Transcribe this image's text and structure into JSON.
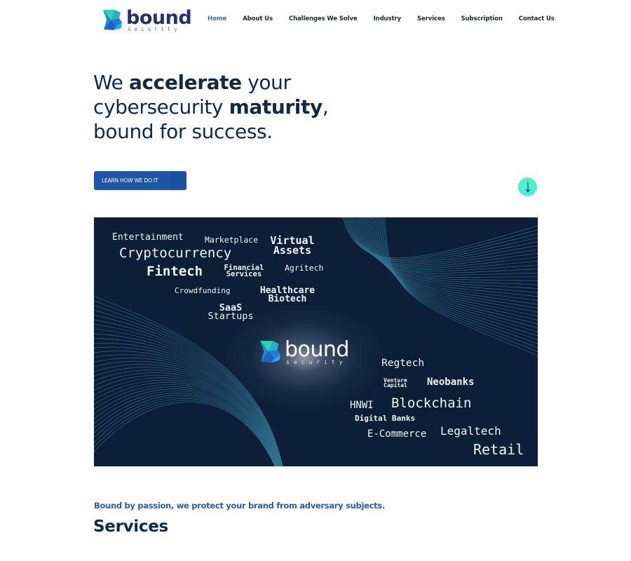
{
  "brand": {
    "name": "bound",
    "subtitle": "security"
  },
  "nav": {
    "items": [
      {
        "label": "Home",
        "active": true
      },
      {
        "label": "About Us"
      },
      {
        "label": "Challenges We Solve"
      },
      {
        "label": "Industry"
      },
      {
        "label": "Services"
      },
      {
        "label": "Subscription"
      },
      {
        "label": "Contact Us"
      }
    ]
  },
  "hero": {
    "line1_pre": "We ",
    "line1_bold": "accelerate",
    "line1_post": " your",
    "line2_pre": "cybersecurity ",
    "line2_bold": "maturity",
    "line2_post": ",",
    "line3": "bound for success.",
    "cta_label": "LEARN HOW WE DO IT",
    "cta_arrow": "›",
    "scroll_icon": "↓"
  },
  "banner": {
    "industries": [
      "Entertainment",
      "Marketplace",
      "Virtual",
      "Assets",
      "Cryptocurrency",
      "Fintech",
      "Financial",
      "Services",
      "Agritech",
      "Crowdfunding",
      "Healthcare",
      "Biotech",
      "SaaS",
      "Startups",
      "Regtech",
      "Venture",
      "Capital",
      "Neobanks",
      "HNWI",
      "Blockchain",
      "Digital Banks",
      "E-Commerce",
      "Legaltech",
      "Retail"
    ]
  },
  "colors": {
    "accent": "#1f55a6",
    "navy": "#0e2a47",
    "teal": "#4ff0d2",
    "banner_bg": "#0d1f38"
  },
  "footer": {
    "tagline": "Bound by passion, we protect your brand from adversary subjects.",
    "section_title": "Services"
  }
}
